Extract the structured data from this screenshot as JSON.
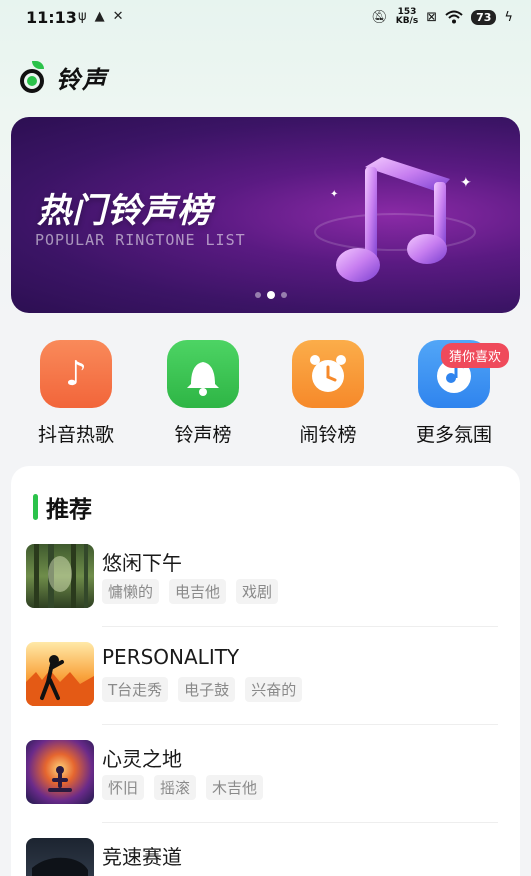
{
  "status_bar": {
    "time": "11:13",
    "net_speed_value": "153",
    "net_speed_unit": "KB/s",
    "battery": "73"
  },
  "header": {
    "title": "铃声"
  },
  "banner": {
    "title": "热门铃声榜",
    "subtitle": "POPULAR RINGTONE LIST",
    "page_count": 3,
    "active_page": 2
  },
  "categories": [
    {
      "label": "抖音热歌",
      "icon": "tiktok-note-icon",
      "color": "#f47a4a"
    },
    {
      "label": "铃声榜",
      "icon": "bell-icon",
      "color": "#3cc452"
    },
    {
      "label": "闹铃榜",
      "icon": "alarm-clock-icon",
      "color": "#f99a32"
    },
    {
      "label": "更多氛围",
      "icon": "music-disc-icon",
      "color": "#3e93f2"
    }
  ],
  "badge": {
    "label": "猜你喜欢"
  },
  "recommend": {
    "title": "推荐",
    "items": [
      {
        "name": "悠闲下午",
        "tags": [
          "慵懒的",
          "电吉他",
          "戏剧"
        ]
      },
      {
        "name": "PERSONALITY",
        "tags": [
          "T台走秀",
          "电子鼓",
          "兴奋的"
        ]
      },
      {
        "name": "心灵之地",
        "tags": [
          "怀旧",
          "摇滚",
          "木吉他"
        ]
      },
      {
        "name": "竞速赛道",
        "tags": []
      }
    ]
  }
}
